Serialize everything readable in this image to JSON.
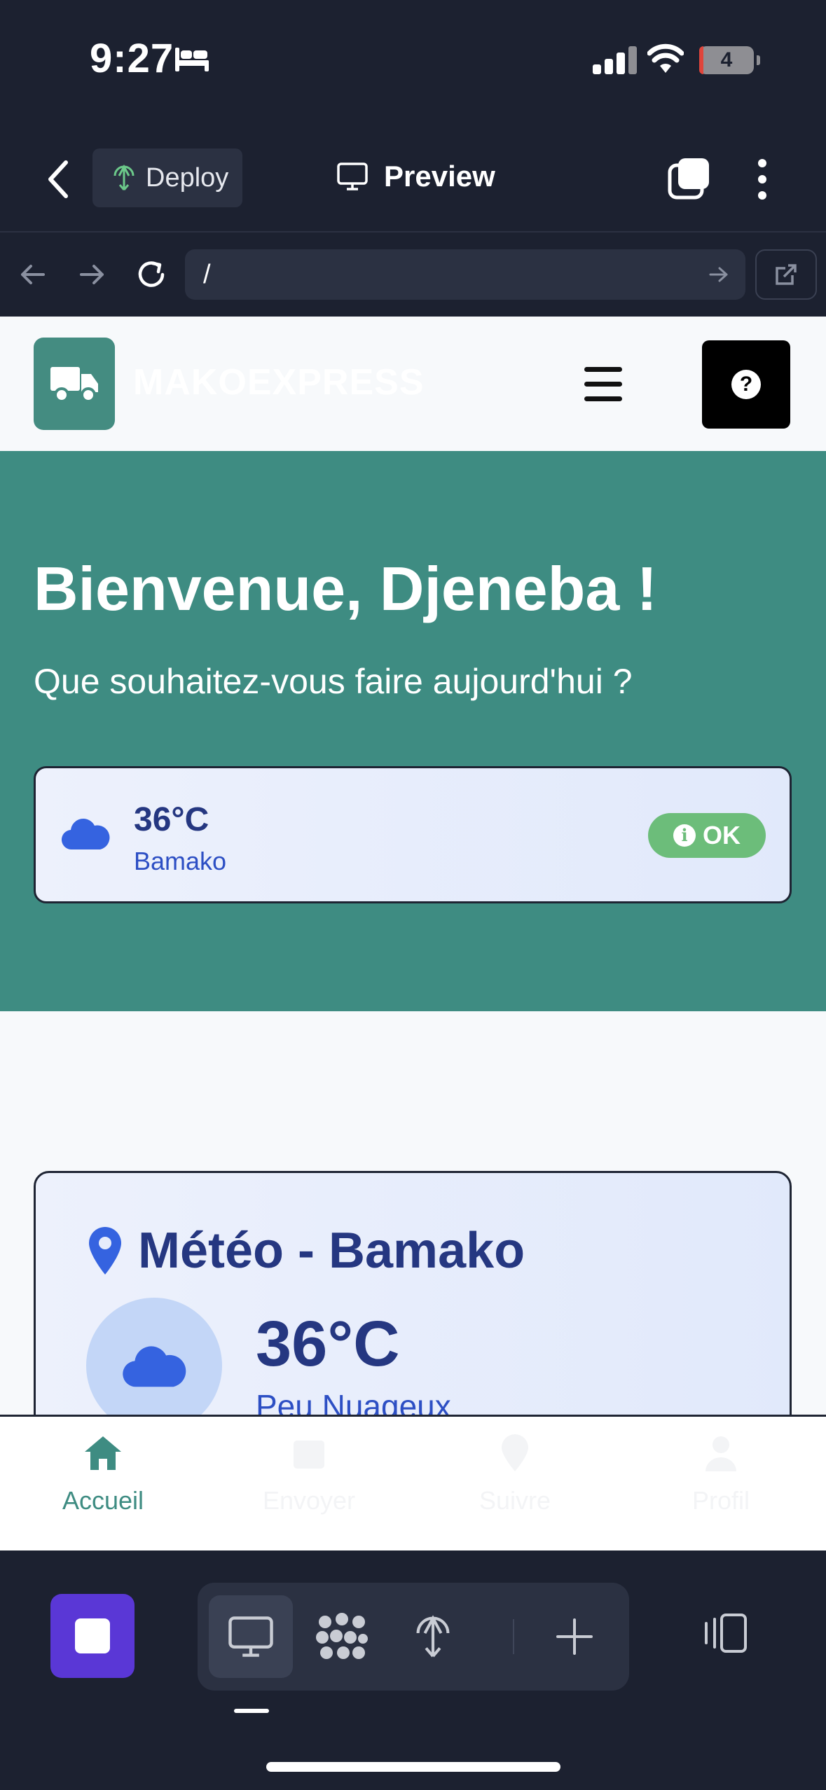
{
  "status_bar": {
    "time": "9:27",
    "battery": "4"
  },
  "toolbar": {
    "deploy_label": "Deploy",
    "preview_label": "Preview"
  },
  "url_bar": {
    "url": "/"
  },
  "app": {
    "brand": "MAKOEXPRESS",
    "help_symbol": "?",
    "hero": {
      "title": "Bienvenue, Djeneba !",
      "subtitle": "Que souhaitez-vous faire aujourd'hui ?"
    },
    "weather_mini": {
      "temp": "36°C",
      "city": "Bamako",
      "status": "OK",
      "status_icon": "i"
    },
    "meteo": {
      "title": "Météo - Bamako",
      "temp": "36°C",
      "desc": "Peu Nuageux"
    }
  },
  "tabs": [
    {
      "label": "Accueil",
      "icon": "home-icon",
      "active": true
    },
    {
      "label": "Envoyer",
      "icon": "package-icon",
      "active": false
    },
    {
      "label": "Suivre",
      "icon": "location-icon",
      "active": false
    },
    {
      "label": "Profil",
      "icon": "user-icon",
      "active": false
    }
  ],
  "colors": {
    "teal": "#3e8c82",
    "navy": "#253781",
    "dark": "#1c2130",
    "stop": "#5a37d6",
    "ok": "#6cbd7a"
  }
}
